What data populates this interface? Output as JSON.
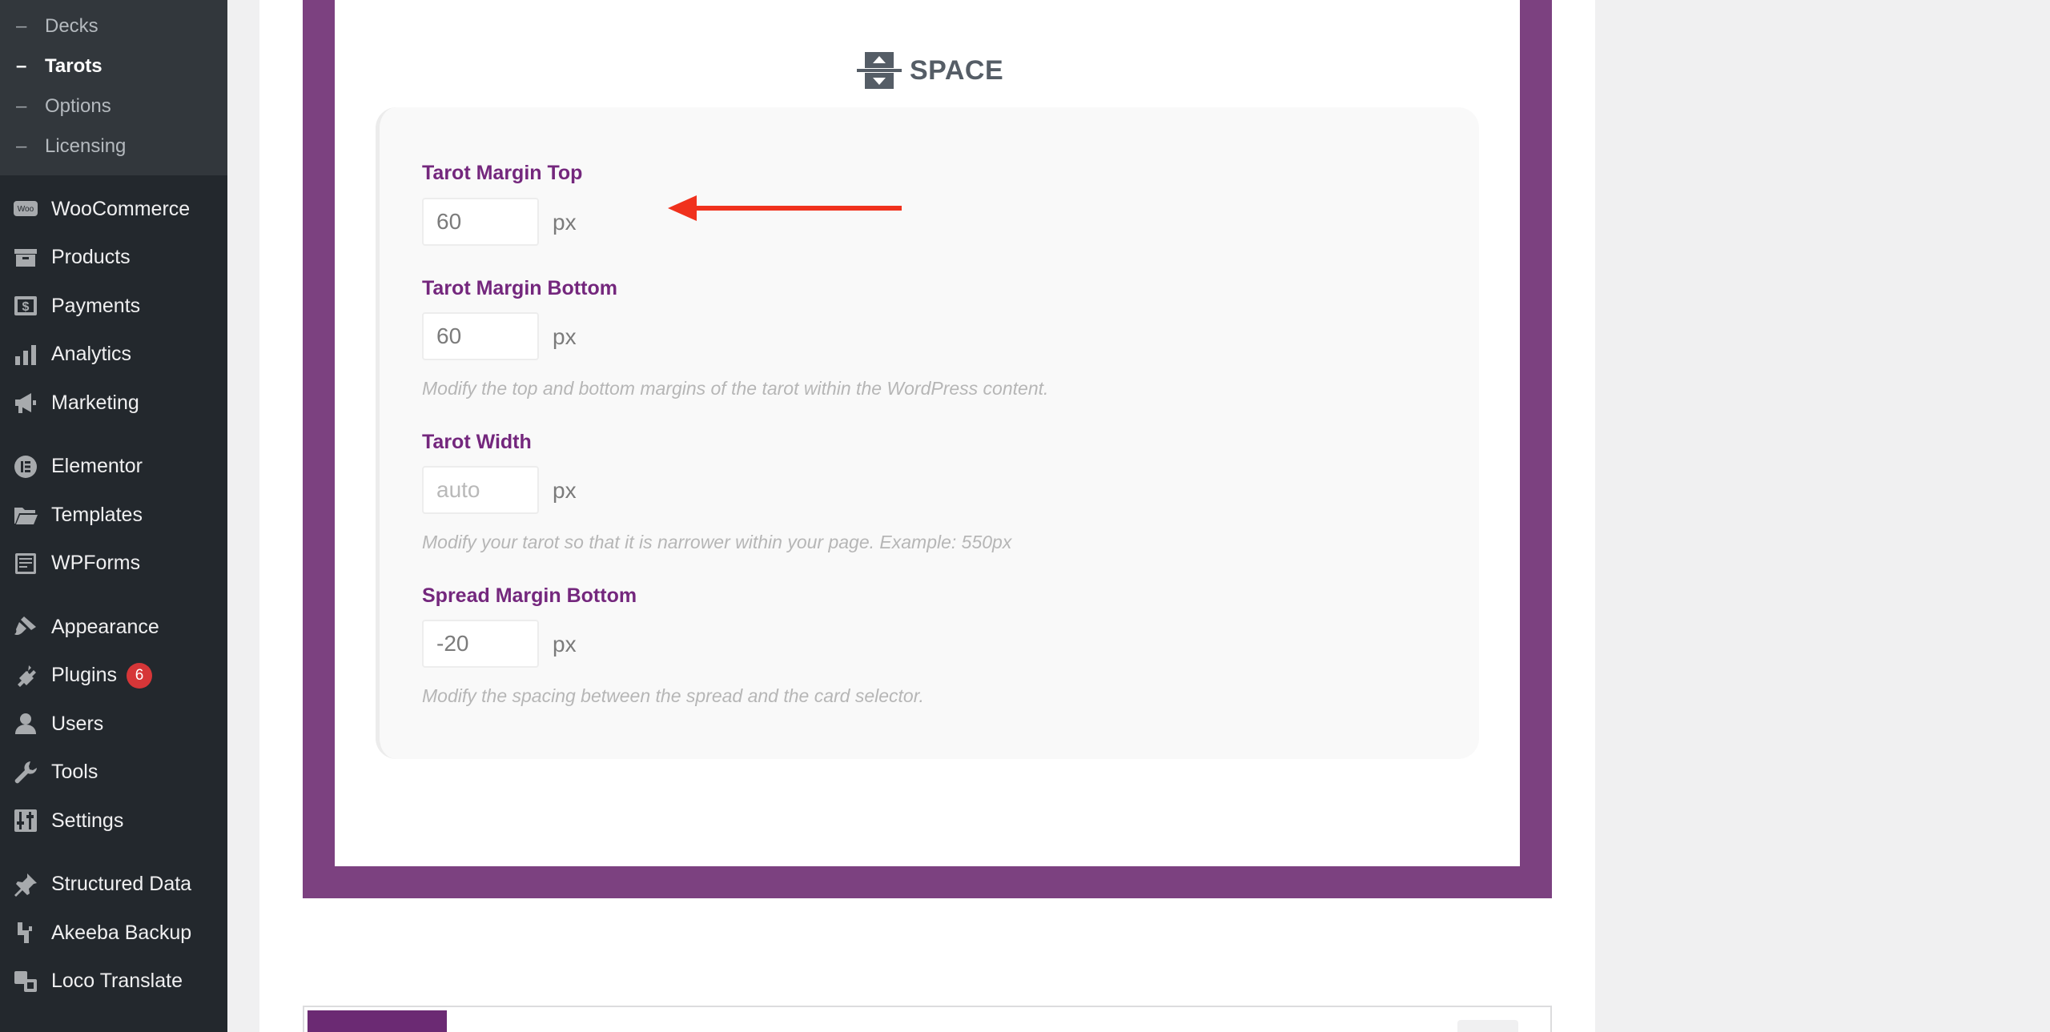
{
  "sidebar": {
    "submenu": [
      {
        "label": "Decks",
        "active": false
      },
      {
        "label": "Tarots",
        "active": true
      },
      {
        "label": "Options",
        "active": false
      },
      {
        "label": "Licensing",
        "active": false
      }
    ],
    "menu": {
      "woocommerce": "WooCommerce",
      "products": "Products",
      "payments": "Payments",
      "analytics": "Analytics",
      "marketing": "Marketing",
      "elementor": "Elementor",
      "templates": "Templates",
      "wpforms": "WPForms",
      "appearance": "Appearance",
      "plugins": "Plugins",
      "plugins_badge": "6",
      "users": "Users",
      "tools": "Tools",
      "settings": "Settings",
      "structured_data": "Structured Data",
      "akeeba": "Akeeba Backup",
      "loco": "Loco Translate"
    },
    "woo_icon_text": "Woo"
  },
  "section": {
    "title": "SPACE"
  },
  "fields": {
    "margin_top": {
      "label": "Tarot Margin Top",
      "value": "60",
      "unit": "px"
    },
    "margin_bottom": {
      "label": "Tarot Margin Bottom",
      "value": "60",
      "unit": "px",
      "help": "Modify the top and bottom margins of the tarot within the WordPress content."
    },
    "width": {
      "label": "Tarot Width",
      "placeholder": "auto",
      "unit": "px",
      "help": "Modify your tarot so that it is narrower within your page. Example: 550px"
    },
    "spread_bottom": {
      "label": "Spread Margin Bottom",
      "value": "-20",
      "unit": "px",
      "help": "Modify the spacing between the spread and the card selector."
    }
  },
  "colors": {
    "accent": "#7c4180",
    "label": "#74277d",
    "arrow": "#f0311d",
    "badge": "#d63638"
  },
  "icons": {
    "space": "space-icon",
    "arrow": "red-arrow-annotation"
  }
}
